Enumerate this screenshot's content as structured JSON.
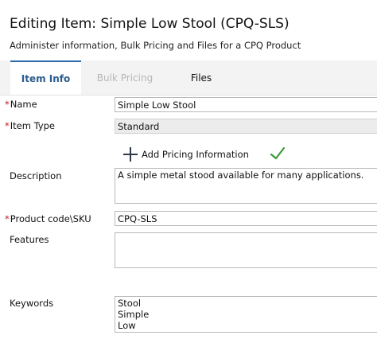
{
  "header": {
    "title": "Editing Item: Simple Low Stool (CPQ-SLS)",
    "subtitle": "Administer information, Bulk Pricing and Files for a CPQ Product"
  },
  "tabs": [
    {
      "label": "Item Info",
      "state": "active"
    },
    {
      "label": "Bulk Pricing",
      "state": "disabled"
    },
    {
      "label": "Files",
      "state": "normal"
    }
  ],
  "form": {
    "required_marker": "*",
    "name": {
      "label": "Name",
      "value": "Simple Low Stool"
    },
    "item_type": {
      "label": "Item Type",
      "value": "Standard"
    },
    "add_pricing": {
      "label": "Add Pricing Information",
      "icon": "plus-icon",
      "status_icon": "check-icon"
    },
    "description": {
      "label": "Description",
      "value": "A simple metal stood available for many applications."
    },
    "product_code": {
      "label": "Product code\\SKU",
      "value": "CPQ-SLS"
    },
    "features": {
      "label": "Features",
      "value": ""
    },
    "keywords": {
      "label": "Keywords",
      "lines": [
        "Stool",
        "Simple",
        "Low"
      ]
    }
  },
  "colors": {
    "active_tab_text": "#2b5c8e",
    "required": "#c21818",
    "check": "#3a9a3a"
  }
}
